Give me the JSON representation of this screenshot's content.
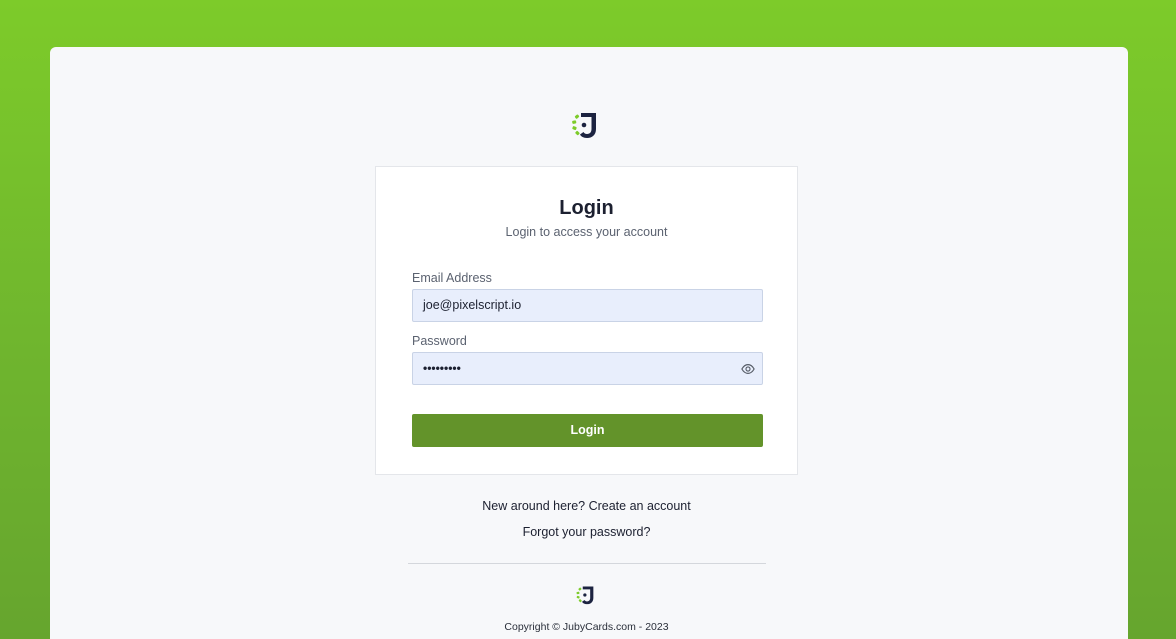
{
  "brand": {
    "logo_icon": "jubycards-logo-icon",
    "accent_color": "#7dcb2a",
    "dark_color": "#1c2340"
  },
  "login_card": {
    "title": "Login",
    "subtitle": "Login to access your account",
    "email": {
      "label": "Email Address",
      "value": "joe@pixelscript.io"
    },
    "password": {
      "label": "Password",
      "value": "•••••••••",
      "toggle_icon": "eye-icon"
    },
    "submit_label": "Login",
    "submit_color": "#63932a"
  },
  "links": {
    "create_account": "New around here? Create an account",
    "forgot_password": "Forgot your password?"
  },
  "footer": {
    "logo_icon": "jubycards-logo-icon",
    "copyright": "Copyright © JubyCards.com - 2023"
  }
}
